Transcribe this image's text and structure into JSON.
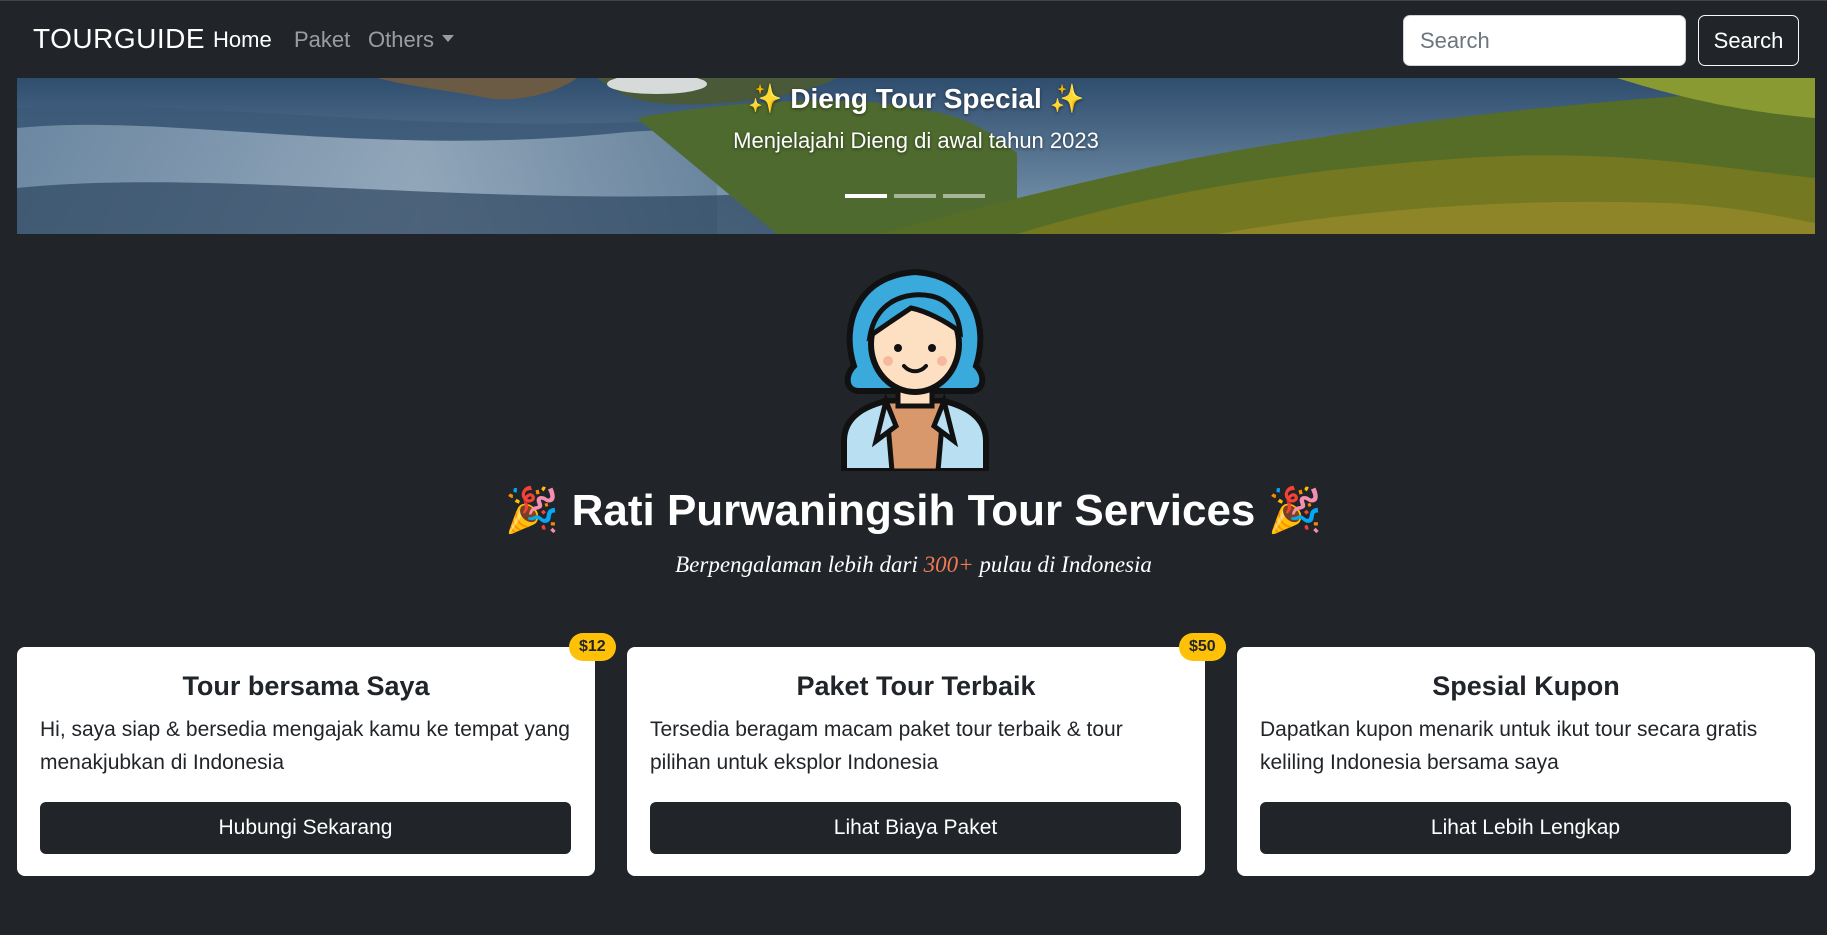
{
  "navbar": {
    "brand": "TOURGUIDE",
    "links": [
      "Home",
      "Paket",
      "Others"
    ],
    "search_placeholder": "Search",
    "search_button": "Search"
  },
  "carousel": {
    "title_prefix": "✨",
    "title": "Dieng Tour Special",
    "title_suffix": "✨",
    "subtitle": "Menjelajahi Dieng di awal tahun 2023",
    "slide_count": 3,
    "active_index": 0
  },
  "hero": {
    "emoji_left": "🎉",
    "title": "Rati Purwaningsih Tour Services",
    "emoji_right": "🎉",
    "subtitle_before": "Berpengalaman lebih dari ",
    "subtitle_highlight": "300+",
    "subtitle_after": " pulau di Indonesia"
  },
  "cards": [
    {
      "title": "Tour bersama Saya",
      "text": "Hi, saya siap & bersedia mengajak kamu ke tempat yang menakjubkan di Indonesia",
      "button": "Hubungi Sekarang",
      "badge": "$12"
    },
    {
      "title": "Paket Tour Terbaik",
      "text": "Tersedia beragam macam paket tour terbaik & tour pilihan untuk eksplor Indonesia",
      "button": "Lihat Biaya Paket",
      "badge": "$50"
    },
    {
      "title": "Spesial Kupon",
      "text": "Dapatkan kupon menarik untuk ikut tour secara gratis keliling Indonesia bersama saya",
      "button": "Lihat Lebih Lengkap",
      "badge": ""
    }
  ],
  "colors": {
    "background": "#212529",
    "highlight": "#f27a54",
    "badge": "#ffc107"
  }
}
